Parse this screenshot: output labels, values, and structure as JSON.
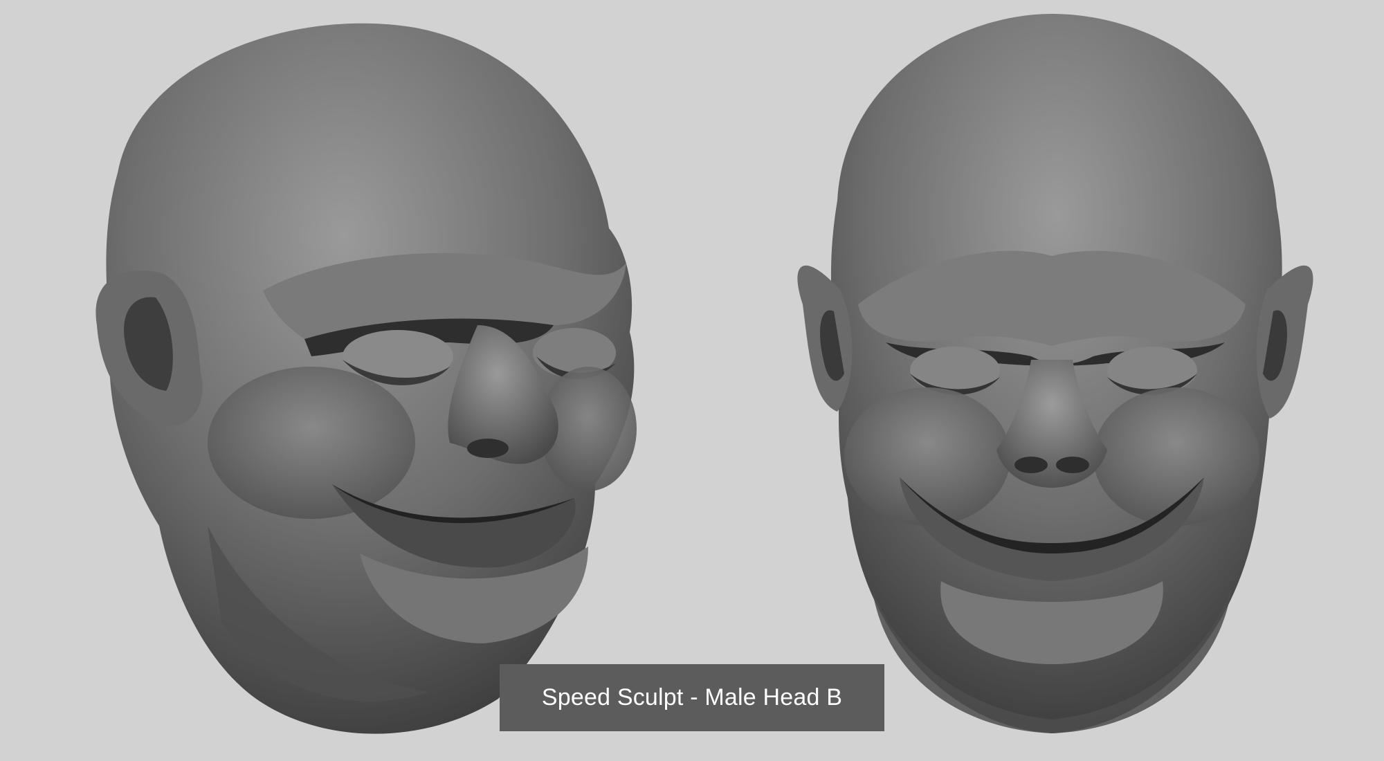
{
  "caption": {
    "title": "Speed Sculpt - Male Head B"
  },
  "colors": {
    "background": "#d2d2d2",
    "caption_background": "#5c5c5c",
    "caption_text": "#ffffff",
    "sculpt_clay": "#6f6f6f"
  },
  "renders": [
    {
      "view": "three-quarter"
    },
    {
      "view": "front"
    }
  ]
}
